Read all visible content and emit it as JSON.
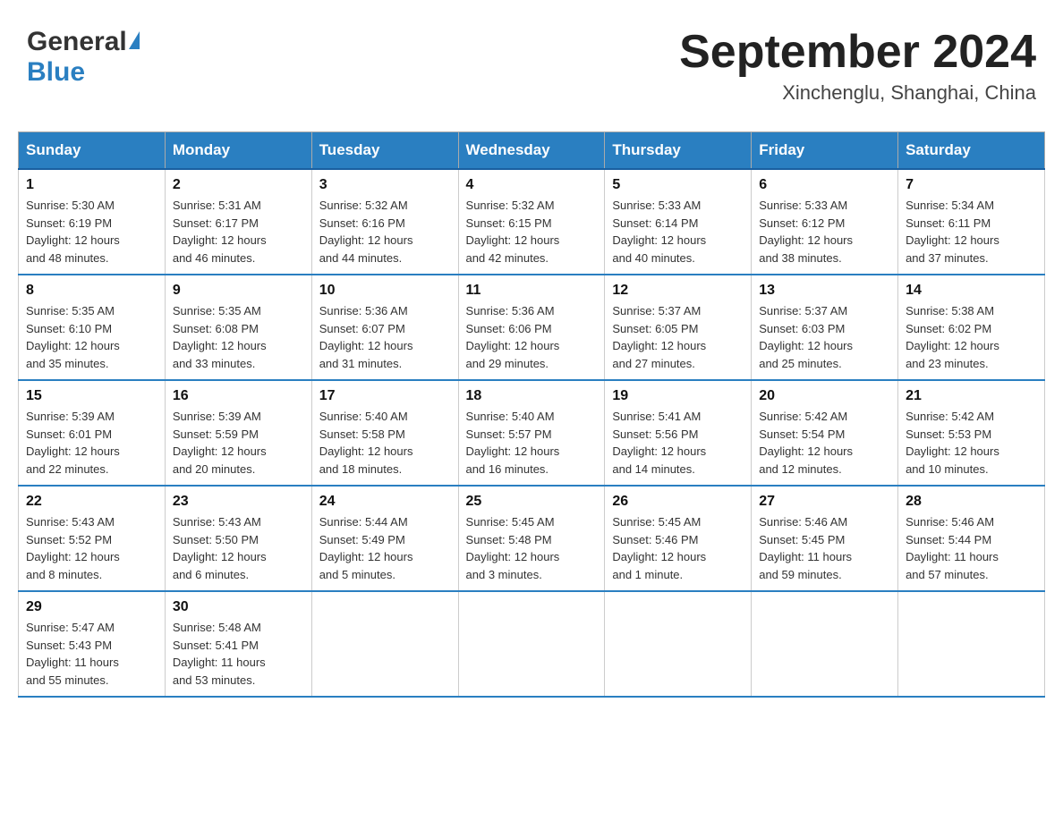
{
  "header": {
    "title": "September 2024",
    "location": "Xinchenglu, Shanghai, China",
    "logo_general": "General",
    "logo_blue": "Blue"
  },
  "days_of_week": [
    "Sunday",
    "Monday",
    "Tuesday",
    "Wednesday",
    "Thursday",
    "Friday",
    "Saturday"
  ],
  "weeks": [
    [
      {
        "num": "1",
        "sunrise": "5:30 AM",
        "sunset": "6:19 PM",
        "daylight": "12 hours and 48 minutes."
      },
      {
        "num": "2",
        "sunrise": "5:31 AM",
        "sunset": "6:17 PM",
        "daylight": "12 hours and 46 minutes."
      },
      {
        "num": "3",
        "sunrise": "5:32 AM",
        "sunset": "6:16 PM",
        "daylight": "12 hours and 44 minutes."
      },
      {
        "num": "4",
        "sunrise": "5:32 AM",
        "sunset": "6:15 PM",
        "daylight": "12 hours and 42 minutes."
      },
      {
        "num": "5",
        "sunrise": "5:33 AM",
        "sunset": "6:14 PM",
        "daylight": "12 hours and 40 minutes."
      },
      {
        "num": "6",
        "sunrise": "5:33 AM",
        "sunset": "6:12 PM",
        "daylight": "12 hours and 38 minutes."
      },
      {
        "num": "7",
        "sunrise": "5:34 AM",
        "sunset": "6:11 PM",
        "daylight": "12 hours and 37 minutes."
      }
    ],
    [
      {
        "num": "8",
        "sunrise": "5:35 AM",
        "sunset": "6:10 PM",
        "daylight": "12 hours and 35 minutes."
      },
      {
        "num": "9",
        "sunrise": "5:35 AM",
        "sunset": "6:08 PM",
        "daylight": "12 hours and 33 minutes."
      },
      {
        "num": "10",
        "sunrise": "5:36 AM",
        "sunset": "6:07 PM",
        "daylight": "12 hours and 31 minutes."
      },
      {
        "num": "11",
        "sunrise": "5:36 AM",
        "sunset": "6:06 PM",
        "daylight": "12 hours and 29 minutes."
      },
      {
        "num": "12",
        "sunrise": "5:37 AM",
        "sunset": "6:05 PM",
        "daylight": "12 hours and 27 minutes."
      },
      {
        "num": "13",
        "sunrise": "5:37 AM",
        "sunset": "6:03 PM",
        "daylight": "12 hours and 25 minutes."
      },
      {
        "num": "14",
        "sunrise": "5:38 AM",
        "sunset": "6:02 PM",
        "daylight": "12 hours and 23 minutes."
      }
    ],
    [
      {
        "num": "15",
        "sunrise": "5:39 AM",
        "sunset": "6:01 PM",
        "daylight": "12 hours and 22 minutes."
      },
      {
        "num": "16",
        "sunrise": "5:39 AM",
        "sunset": "5:59 PM",
        "daylight": "12 hours and 20 minutes."
      },
      {
        "num": "17",
        "sunrise": "5:40 AM",
        "sunset": "5:58 PM",
        "daylight": "12 hours and 18 minutes."
      },
      {
        "num": "18",
        "sunrise": "5:40 AM",
        "sunset": "5:57 PM",
        "daylight": "12 hours and 16 minutes."
      },
      {
        "num": "19",
        "sunrise": "5:41 AM",
        "sunset": "5:56 PM",
        "daylight": "12 hours and 14 minutes."
      },
      {
        "num": "20",
        "sunrise": "5:42 AM",
        "sunset": "5:54 PM",
        "daylight": "12 hours and 12 minutes."
      },
      {
        "num": "21",
        "sunrise": "5:42 AM",
        "sunset": "5:53 PM",
        "daylight": "12 hours and 10 minutes."
      }
    ],
    [
      {
        "num": "22",
        "sunrise": "5:43 AM",
        "sunset": "5:52 PM",
        "daylight": "12 hours and 8 minutes."
      },
      {
        "num": "23",
        "sunrise": "5:43 AM",
        "sunset": "5:50 PM",
        "daylight": "12 hours and 6 minutes."
      },
      {
        "num": "24",
        "sunrise": "5:44 AM",
        "sunset": "5:49 PM",
        "daylight": "12 hours and 5 minutes."
      },
      {
        "num": "25",
        "sunrise": "5:45 AM",
        "sunset": "5:48 PM",
        "daylight": "12 hours and 3 minutes."
      },
      {
        "num": "26",
        "sunrise": "5:45 AM",
        "sunset": "5:46 PM",
        "daylight": "12 hours and 1 minute."
      },
      {
        "num": "27",
        "sunrise": "5:46 AM",
        "sunset": "5:45 PM",
        "daylight": "11 hours and 59 minutes."
      },
      {
        "num": "28",
        "sunrise": "5:46 AM",
        "sunset": "5:44 PM",
        "daylight": "11 hours and 57 minutes."
      }
    ],
    [
      {
        "num": "29",
        "sunrise": "5:47 AM",
        "sunset": "5:43 PM",
        "daylight": "11 hours and 55 minutes."
      },
      {
        "num": "30",
        "sunrise": "5:48 AM",
        "sunset": "5:41 PM",
        "daylight": "11 hours and 53 minutes."
      },
      null,
      null,
      null,
      null,
      null
    ]
  ],
  "labels": {
    "sunrise": "Sunrise:",
    "sunset": "Sunset:",
    "daylight": "Daylight:"
  }
}
